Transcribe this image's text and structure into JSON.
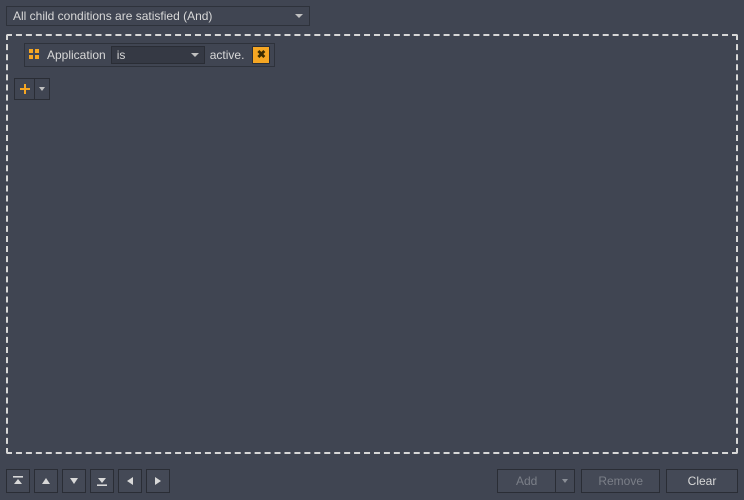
{
  "topDropdown": {
    "selected": "All child conditions are satisfied (And)"
  },
  "condition": {
    "labelBefore": "Application",
    "operatorSelected": "is",
    "labelAfter": "active."
  },
  "bottomButtons": {
    "add": "Add",
    "remove": "Remove",
    "clear": "Clear"
  },
  "colors": {
    "accent": "#f5a623",
    "panel": "#404552",
    "inputBg": "#353944",
    "border": "#2a2d35"
  }
}
